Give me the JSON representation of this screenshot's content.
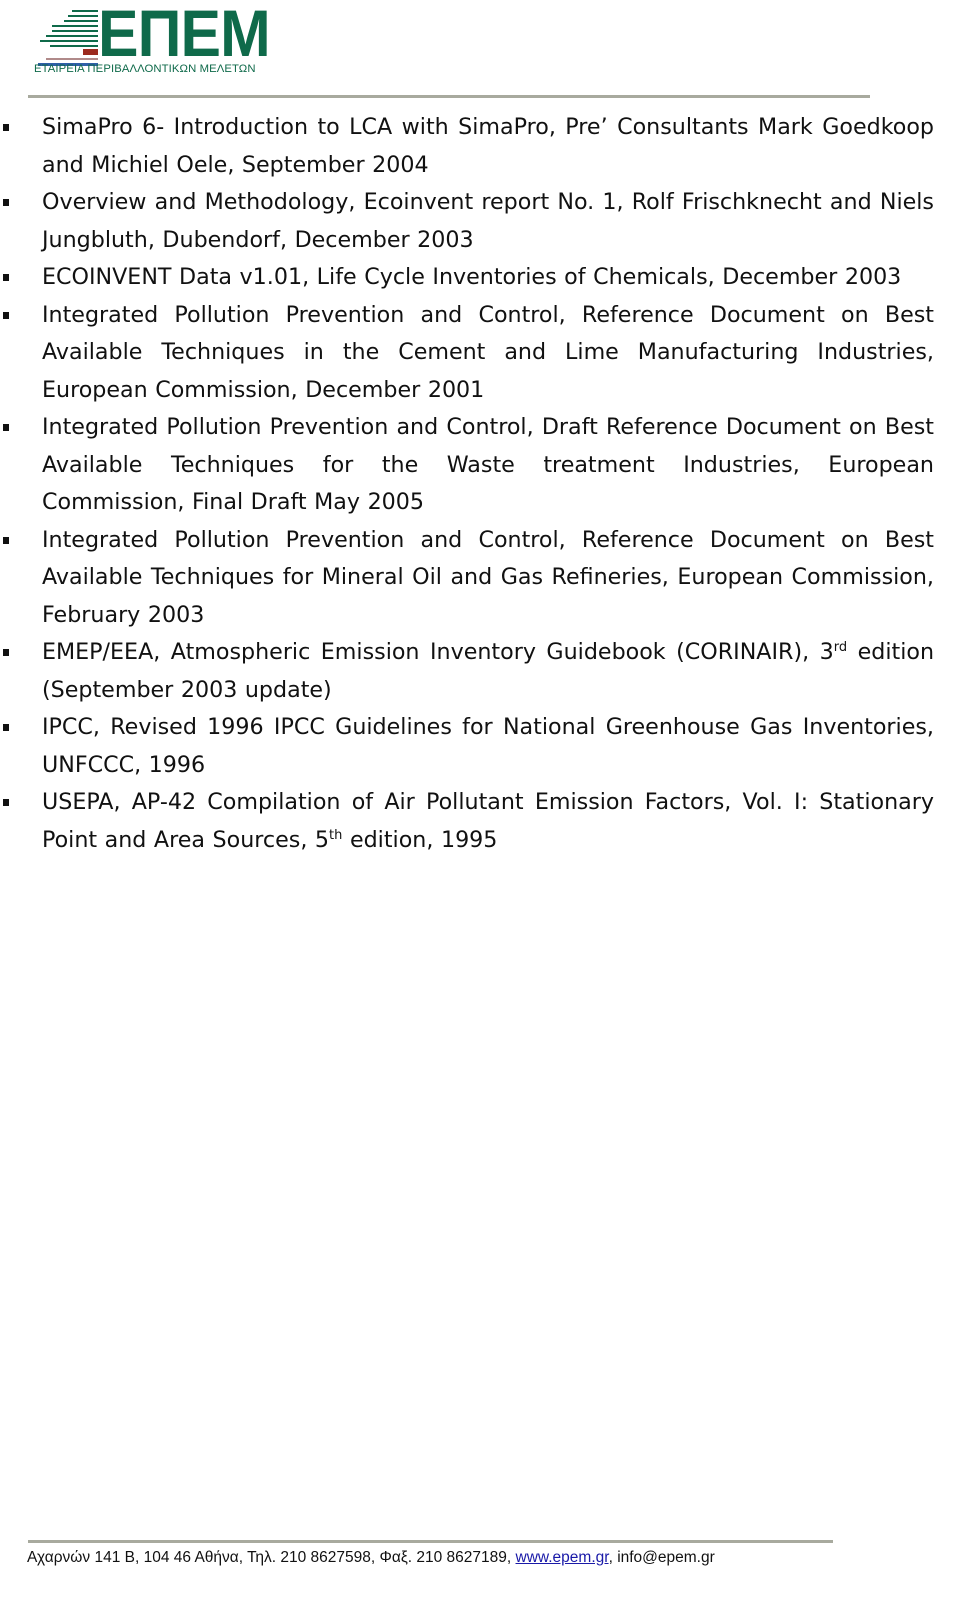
{
  "header": {
    "logo": {
      "wordmark": "ΕΠΕΜ",
      "subtitle": "ΕΤΑΙΡΕΙΑ ΠΕΡΙΒΑΛΛΟΝΤΙΚΩΝ ΜΕΛΕΤΩΝ",
      "brand_color": "#0f6a4a",
      "accent_red": "#9c2a1e",
      "accent_blue": "#2f5fa8",
      "accent_gray": "#b08a8a"
    }
  },
  "references": [
    {
      "text": "SimaPro 6- Introduction to LCA with SimaPro, Pre’ Consultants Mark Goedkoop and Michiel Oele, September 2004"
    },
    {
      "text": "Overview and Methodology, Ecoinvent report No. 1, Rolf Frischknecht and Niels Jungbluth, Dubendorf, December 2003"
    },
    {
      "text": "ECOINVENT Data v1.01, Life Cycle Inventories of Chemicals, December 2003"
    },
    {
      "text": "Integrated Pollution Prevention and Control, Reference Document on Best Available Techniques in the Cement and Lime Manufacturing Industries, European Commission, December 2001"
    },
    {
      "text": "Integrated Pollution Prevention and Control, Draft Reference Document on Best Available Techniques for the Waste treatment Industries, European Commission, Final Draft May 2005"
    },
    {
      "text": "Integrated Pollution Prevention and Control, Reference Document on Best Available Techniques for Mineral Oil and Gas Refineries, European Commission, February 2003"
    },
    {
      "text_before": "EMEP/EEA, Atmospheric Emission Inventory Guidebook (CORINAIR), 3",
      "sup": "rd",
      "text_after": " edition (September 2003 update)"
    },
    {
      "text": "IPCC, Revised 1996 IPCC Guidelines for National Greenhouse Gas Inventories, UNFCCC, 1996"
    },
    {
      "text_before": "USEPA, AP-42 Compilation of Air Pollutant Emission Factors, Vol. I: Stationary Point and Area Sources, 5",
      "sup": "th",
      "text_after": " edition, 1995"
    }
  ],
  "footer": {
    "address": "Αχαρνών 141 Β, 104 46 Αθήνα, Τηλ. 210 8627598, Φαξ. 210 8627189, ",
    "website": "www.epem.gr",
    "separator": ", ",
    "email": "info@epem.gr",
    "link_color": "#1a1aa8"
  }
}
